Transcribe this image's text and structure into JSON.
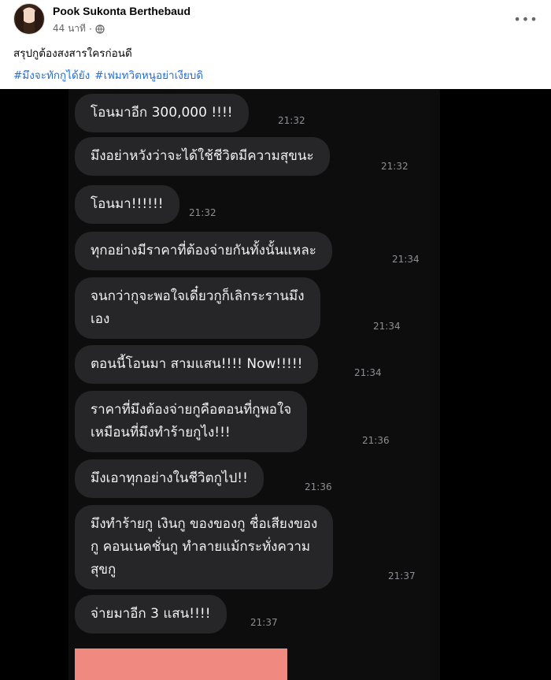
{
  "post": {
    "author": "Pook Sukonta Berthebaud",
    "time": "44 นาที",
    "dot": "·",
    "more": "•••",
    "text": "สรุปกูต้องสงสารใครก่อนดี",
    "hashtags": [
      "#มึงจะทักกูได้ยัง",
      "#เฟมทวิตหนูอย่าเงียบดิ"
    ]
  },
  "chat": {
    "messages": [
      {
        "text": "โอนมาอีก 300,000 !!!!",
        "time": "21:32"
      },
      {
        "text": "มึงอย่าหวังว่าจะได้ใช้ชีวิตมีความสุขนะ",
        "time": "21:32"
      },
      {
        "text": "โอนมา!!!!!!",
        "time": "21:32"
      },
      {
        "text": "ทุกอย่างมีราคาที่ต้องจ่ายกันทั้งนั้นแหละ",
        "time": "21:34"
      },
      {
        "text": "จนกว่ากูจะพอใจเดี๋ยวกูก็เลิกระรานมึง\nเอง",
        "time": "21:34"
      },
      {
        "text": "ตอนนี้โอนมา สามแสน!!!! Now!!!!!",
        "time": "21:34"
      },
      {
        "text": "ราคาที่มึงต้องจ่ายกูคือตอนที่กูพอใจ\nเหมือนที่มึงทำร้ายกูไง!!!",
        "time": "21:36"
      },
      {
        "text": "มึงเอาทุกอย่างในชีวิตกูไป!!",
        "time": "21:36"
      },
      {
        "text": "มึงทำร้ายกู เงินกู ของของกู ชื่อเสียงของ\nกู คอนเนคชั่นกู ทำลายแม้กระทั่งความ\nสุขกู",
        "time": "21:37"
      },
      {
        "text": "จ่ายมาอีก 3 แสน!!!!",
        "time": "21:37"
      }
    ]
  },
  "colors": {
    "link": "#216fdb",
    "bubble": "#262628",
    "redaction": "#f08a80"
  }
}
